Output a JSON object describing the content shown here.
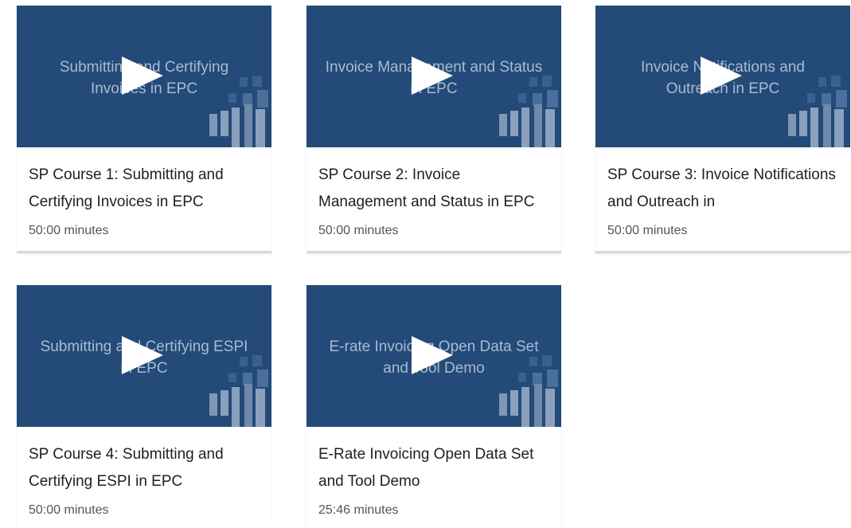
{
  "colors": {
    "thumbnail_bg": "#234a78",
    "thumbnail_text": "#a9bbd2",
    "play_icon": "#ffffff",
    "card_border": "#d9d9d9"
  },
  "courses": [
    {
      "thumb_text": "Submitting and Certifying Invoices in EPC",
      "title": "SP Course 1: Submitting and Certifying Invoices in EPC",
      "duration": "50:00 minutes"
    },
    {
      "thumb_text": "Invoice Management and Status in EPC",
      "title": "SP Course 2: Invoice Management and Status in EPC",
      "duration": "50:00 minutes"
    },
    {
      "thumb_text": "Invoice Notifications and Outreach in EPC",
      "title": "SP Course 3: Invoice Notifications and Outreach in",
      "duration": "50:00 minutes"
    },
    {
      "thumb_text": "Submitting and Certifying ESPI in EPC",
      "title": "SP Course 4: Submitting and Certifying ESPI in EPC",
      "duration": "50:00 minutes"
    },
    {
      "thumb_text": "E-rate Invoicing Open Data Set and Tool Demo",
      "title": "E-Rate Invoicing Open Data Set and Tool Demo",
      "duration": "25:46 minutes"
    }
  ]
}
